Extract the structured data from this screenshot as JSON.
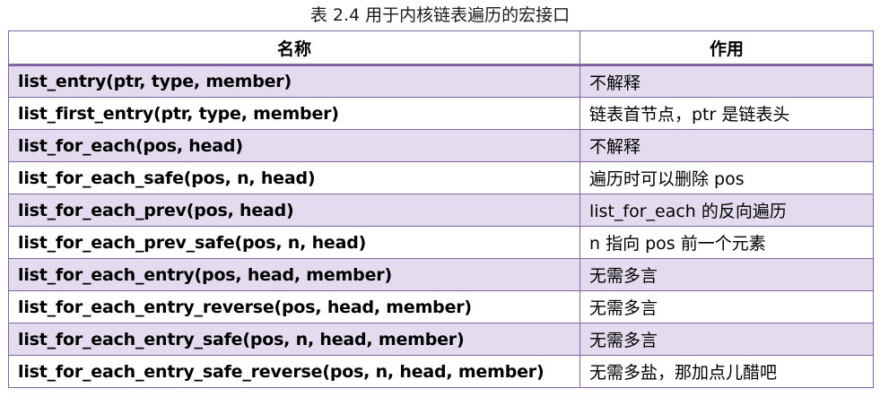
{
  "caption": "表 2.4  用于内核链表遍历的宏接口",
  "table": {
    "headers": [
      "名称",
      "作用"
    ],
    "rows": [
      {
        "name": "list_entry(ptr, type, member)",
        "desc": "不解释"
      },
      {
        "name": "list_first_entry(ptr, type, member)",
        "desc": "链表首节点，ptr 是链表头"
      },
      {
        "name": "list_for_each(pos, head)",
        "desc": "不解释"
      },
      {
        "name": "list_for_each_safe(pos, n, head)",
        "desc": "遍历时可以删除 pos"
      },
      {
        "name": "list_for_each_prev(pos, head)",
        "desc": "list_for_each 的反向遍历"
      },
      {
        "name": "list_for_each_prev_safe(pos, n, head)",
        "desc": "n 指向 pos 前一个元素"
      },
      {
        "name": "list_for_each_entry(pos, head, member)",
        "desc": "无需多言"
      },
      {
        "name": "list_for_each_entry_reverse(pos, head, member)",
        "desc": "无需多言"
      },
      {
        "name": "list_for_each_entry_safe(pos, n, head, member)",
        "desc": "无需多言"
      },
      {
        "name": "list_for_each_entry_safe_reverse(pos, n, head, member)",
        "desc": "无需多盐，那加点儿醋吧"
      }
    ]
  },
  "colors": {
    "border": "#8064a2",
    "band": "#e2dcee"
  }
}
